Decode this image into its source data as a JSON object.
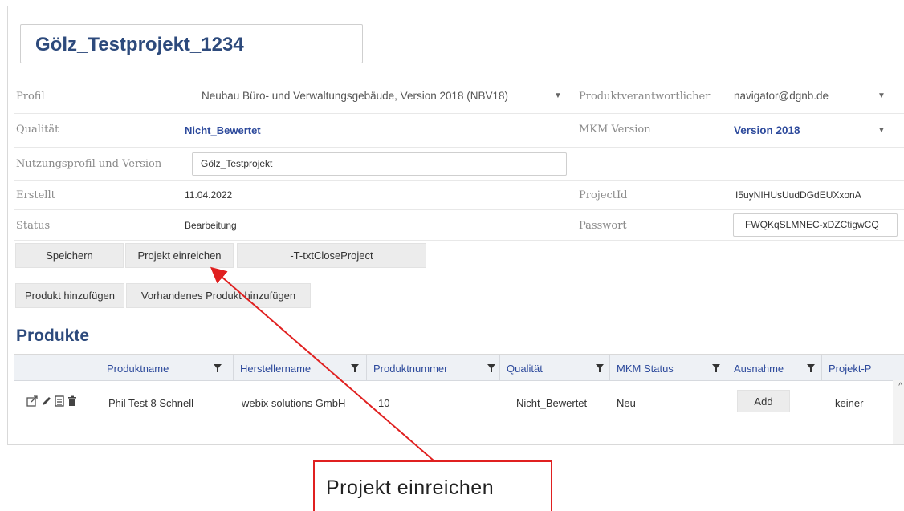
{
  "project": {
    "title": "Gölz_Testprojekt_1234"
  },
  "fields": {
    "profil_label": "Profil",
    "profil_value": "Neubau Büro- und Verwaltungsgebäude, Version 2018 (NBV18)",
    "produktverantwortlicher_label": "Produktverantwortlicher",
    "produktverantwortlicher_value": "navigator@dgnb.de",
    "qualitaet_label": "Qualität",
    "qualitaet_value": "Nicht_Bewertet",
    "mkm_version_label": "MKM Version",
    "mkm_version_value": "Version 2018",
    "nutzungsprofil_label": "Nutzungsprofil und Version",
    "nutzungsprofil_value": "Gölz_Testprojekt",
    "erstellt_label": "Erstellt",
    "erstellt_value": "11.04.2022",
    "projectid_label": "ProjectId",
    "projectid_value": "I5uyNIHUsUudDGdEUXxonA",
    "status_label": "Status",
    "status_value": "Bearbeitung",
    "passwort_label": "Passwort",
    "passwort_value": "FWQKqSLMNEC-xDZCtigwCQ"
  },
  "buttons": {
    "speichern": "Speichern",
    "projekt_einreichen": "Projekt einreichen",
    "close_project": "-T-txtCloseProject",
    "produkt_hinzufuegen": "Produkt hinzufügen",
    "vorhandenes_produkt": "Vorhandenes Produkt hinzufügen"
  },
  "products": {
    "section_title": "Produkte",
    "columns": [
      "Produktname",
      "Herstellername",
      "Produktnummer",
      "Qualität",
      "MKM Status",
      "Ausnahme",
      "Projekt-P"
    ],
    "rows": [
      {
        "produktname": "Phil Test 8 Schnell",
        "herstellername": "webix solutions GmbH",
        "produktnummer": "10",
        "qualitaet": "Nicht_Bewertet",
        "mkm_status": "Neu",
        "ausnahme_button": "Add",
        "projekt_p": "keiner"
      }
    ],
    "row_icons": [
      "open-external-icon",
      "pencil-icon",
      "document-icon",
      "trash-icon"
    ]
  },
  "annotation": {
    "callout_text": "Projekt einreichen",
    "color": "#e02020"
  },
  "colors": {
    "title_blue": "#2d4a7c",
    "link_blue": "#2d4a9c",
    "header_bg": "#eef1f5",
    "button_bg": "#ececec"
  }
}
